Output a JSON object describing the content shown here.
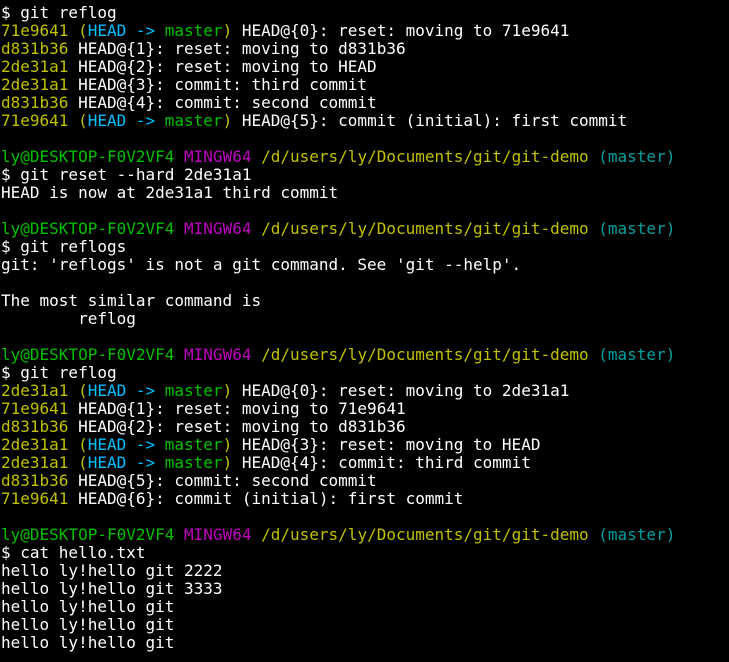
{
  "colors": {
    "background": "#000000",
    "default": "#ffffff",
    "yellow": "#c0c000",
    "cyan": "#00c0ff",
    "green": "#00c000",
    "magenta": "#c000c0",
    "teal": "#00a0a0"
  },
  "terminal": {
    "lines": [
      [
        {
          "t": "$ git reflog",
          "c": "default"
        }
      ],
      [
        {
          "t": "71e9641",
          "c": "yellow"
        },
        {
          "t": " (",
          "c": "yellow"
        },
        {
          "t": "HEAD -> ",
          "c": "cyan"
        },
        {
          "t": "master",
          "c": "green"
        },
        {
          "t": ")",
          "c": "yellow"
        },
        {
          "t": " HEAD@{0}: reset: moving to 71e9641",
          "c": "default"
        }
      ],
      [
        {
          "t": "d831b36",
          "c": "yellow"
        },
        {
          "t": " HEAD@{1}: reset: moving to d831b36",
          "c": "default"
        }
      ],
      [
        {
          "t": "2de31a1",
          "c": "yellow"
        },
        {
          "t": " HEAD@{2}: reset: moving to HEAD",
          "c": "default"
        }
      ],
      [
        {
          "t": "2de31a1",
          "c": "yellow"
        },
        {
          "t": " HEAD@{3}: commit: third commit",
          "c": "default"
        }
      ],
      [
        {
          "t": "d831b36",
          "c": "yellow"
        },
        {
          "t": " HEAD@{4}: commit: second commit",
          "c": "default"
        }
      ],
      [
        {
          "t": "71e9641",
          "c": "yellow"
        },
        {
          "t": " (",
          "c": "yellow"
        },
        {
          "t": "HEAD -> ",
          "c": "cyan"
        },
        {
          "t": "master",
          "c": "green"
        },
        {
          "t": ")",
          "c": "yellow"
        },
        {
          "t": " HEAD@{5}: commit (initial): first commit",
          "c": "default"
        }
      ],
      [
        {
          "t": "",
          "c": "default"
        }
      ],
      [
        {
          "t": "ly@DESKTOP-F0V2VF4",
          "c": "green"
        },
        {
          "t": " ",
          "c": "default"
        },
        {
          "t": "MINGW64",
          "c": "magenta"
        },
        {
          "t": " ",
          "c": "default"
        },
        {
          "t": "/d/users/ly/Documents/git/git-demo",
          "c": "yellow"
        },
        {
          "t": " ",
          "c": "default"
        },
        {
          "t": "(master)",
          "c": "teal"
        }
      ],
      [
        {
          "t": "$ git reset --hard 2de31a1",
          "c": "default"
        }
      ],
      [
        {
          "t": "HEAD is now at 2de31a1 third commit",
          "c": "default"
        }
      ],
      [
        {
          "t": "",
          "c": "default"
        }
      ],
      [
        {
          "t": "ly@DESKTOP-F0V2VF4",
          "c": "green"
        },
        {
          "t": " ",
          "c": "default"
        },
        {
          "t": "MINGW64",
          "c": "magenta"
        },
        {
          "t": " ",
          "c": "default"
        },
        {
          "t": "/d/users/ly/Documents/git/git-demo",
          "c": "yellow"
        },
        {
          "t": " ",
          "c": "default"
        },
        {
          "t": "(master)",
          "c": "teal"
        }
      ],
      [
        {
          "t": "$ git reflogs",
          "c": "default"
        }
      ],
      [
        {
          "t": "git: 'reflogs' is not a git command. See 'git --help'.",
          "c": "default"
        }
      ],
      [
        {
          "t": "",
          "c": "default"
        }
      ],
      [
        {
          "t": "The most similar command is",
          "c": "default"
        }
      ],
      [
        {
          "t": "        reflog",
          "c": "default"
        }
      ],
      [
        {
          "t": "",
          "c": "default"
        }
      ],
      [
        {
          "t": "ly@DESKTOP-F0V2VF4",
          "c": "green"
        },
        {
          "t": " ",
          "c": "default"
        },
        {
          "t": "MINGW64",
          "c": "magenta"
        },
        {
          "t": " ",
          "c": "default"
        },
        {
          "t": "/d/users/ly/Documents/git/git-demo",
          "c": "yellow"
        },
        {
          "t": " ",
          "c": "default"
        },
        {
          "t": "(master)",
          "c": "teal"
        }
      ],
      [
        {
          "t": "$ git reflog",
          "c": "default"
        }
      ],
      [
        {
          "t": "2de31a1",
          "c": "yellow"
        },
        {
          "t": " (",
          "c": "yellow"
        },
        {
          "t": "HEAD -> ",
          "c": "cyan"
        },
        {
          "t": "master",
          "c": "green"
        },
        {
          "t": ")",
          "c": "yellow"
        },
        {
          "t": " HEAD@{0}: reset: moving to 2de31a1",
          "c": "default"
        }
      ],
      [
        {
          "t": "71e9641",
          "c": "yellow"
        },
        {
          "t": " HEAD@{1}: reset: moving to 71e9641",
          "c": "default"
        }
      ],
      [
        {
          "t": "d831b36",
          "c": "yellow"
        },
        {
          "t": " HEAD@{2}: reset: moving to d831b36",
          "c": "default"
        }
      ],
      [
        {
          "t": "2de31a1",
          "c": "yellow"
        },
        {
          "t": " (",
          "c": "yellow"
        },
        {
          "t": "HEAD -> ",
          "c": "cyan"
        },
        {
          "t": "master",
          "c": "green"
        },
        {
          "t": ")",
          "c": "yellow"
        },
        {
          "t": " HEAD@{3}: reset: moving to HEAD",
          "c": "default"
        }
      ],
      [
        {
          "t": "2de31a1",
          "c": "yellow"
        },
        {
          "t": " (",
          "c": "yellow"
        },
        {
          "t": "HEAD -> ",
          "c": "cyan"
        },
        {
          "t": "master",
          "c": "green"
        },
        {
          "t": ")",
          "c": "yellow"
        },
        {
          "t": " HEAD@{4}: commit: third commit",
          "c": "default"
        }
      ],
      [
        {
          "t": "d831b36",
          "c": "yellow"
        },
        {
          "t": " HEAD@{5}: commit: second commit",
          "c": "default"
        }
      ],
      [
        {
          "t": "71e9641",
          "c": "yellow"
        },
        {
          "t": " HEAD@{6}: commit (initial): first commit",
          "c": "default"
        }
      ],
      [
        {
          "t": "",
          "c": "default"
        }
      ],
      [
        {
          "t": "ly@DESKTOP-F0V2VF4",
          "c": "green"
        },
        {
          "t": " ",
          "c": "default"
        },
        {
          "t": "MINGW64",
          "c": "magenta"
        },
        {
          "t": " ",
          "c": "default"
        },
        {
          "t": "/d/users/ly/Documents/git/git-demo",
          "c": "yellow"
        },
        {
          "t": " ",
          "c": "default"
        },
        {
          "t": "(master)",
          "c": "teal"
        }
      ],
      [
        {
          "t": "$ cat hello.txt",
          "c": "default"
        }
      ],
      [
        {
          "t": "hello ly!hello git 2222",
          "c": "default"
        }
      ],
      [
        {
          "t": "hello ly!hello git 3333",
          "c": "default"
        }
      ],
      [
        {
          "t": "hello ly!hello git",
          "c": "default"
        }
      ],
      [
        {
          "t": "hello ly!hello git",
          "c": "default"
        }
      ],
      [
        {
          "t": "hello ly!hello git",
          "c": "default"
        }
      ]
    ]
  }
}
